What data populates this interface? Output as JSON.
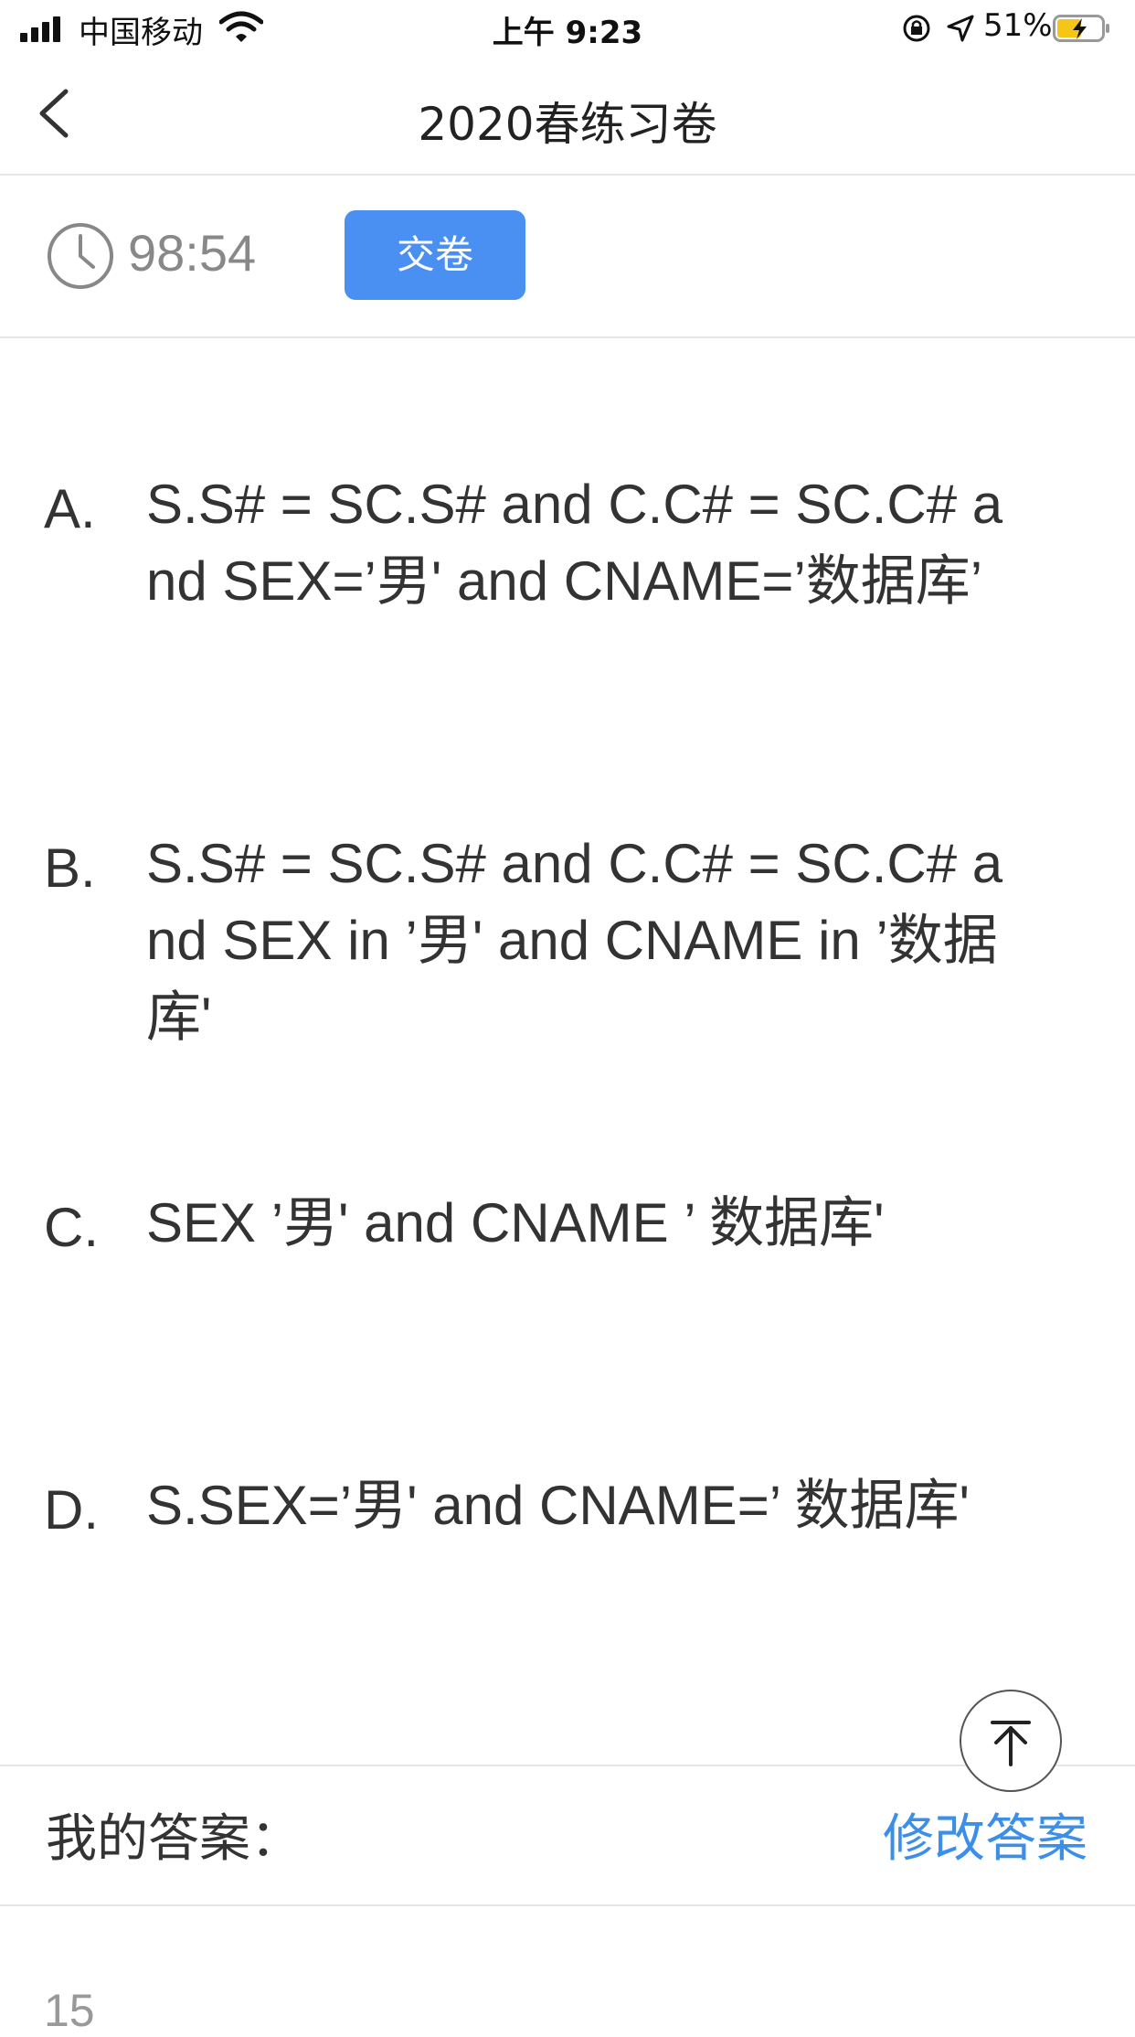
{
  "status_bar": {
    "carrier": "中国移动",
    "time": "上午 9:23",
    "battery": "51%"
  },
  "nav": {
    "title": "2020春练习卷"
  },
  "exam": {
    "timer": "98:54",
    "submit_label": "交卷"
  },
  "options": [
    {
      "letter": "A.",
      "text": "S.S# = SC.S# and C.C# = SC.C# and SEX=’男' and CNAME=’数据库’"
    },
    {
      "letter": "B.",
      "text": "S.S# = SC.S# and C.C# = SC.C# and SEX in ’男' and CNAME in ’数据库'"
    },
    {
      "letter": "C.",
      "text": "SEX ’男' and CNAME ’ 数据库'"
    },
    {
      "letter": "D.",
      "text": "S.SEX=’男' and CNAME=’ 数据库'"
    }
  ],
  "answer": {
    "label": "我的答案：",
    "modify_label": "修改答案"
  },
  "next_question_number": "15",
  "colors": {
    "accent": "#4a90f2",
    "link": "#3b8fe8"
  }
}
